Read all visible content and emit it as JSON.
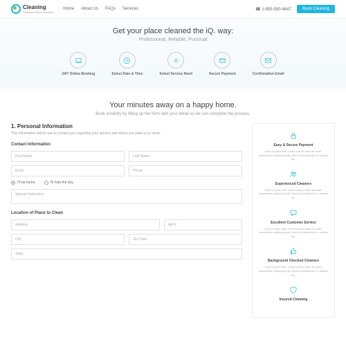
{
  "brand": {
    "name": "Cleaning",
    "tagline": "Premium Home Services"
  },
  "nav": {
    "links": [
      "Home",
      "About Us",
      "FAQs",
      "Services"
    ],
    "phone": "☎ 1-855-550-4647",
    "cta": "Book Cleaning"
  },
  "hero": {
    "title": "Get your place cleaned the iQ. way:",
    "subtitle": "Professional, Reliable, Punctual"
  },
  "steps": [
    {
      "label": "24/7 Online Booking"
    },
    {
      "label": "Select Date & Time"
    },
    {
      "label": "Select Service Need"
    },
    {
      "label": "Secure Payment"
    },
    {
      "label": "Confirmation Email"
    }
  ],
  "mid": {
    "title": "Your minutes away on a happy home.",
    "subtitle": "Book instantly by filling up the form with your detail so we can complete the process."
  },
  "form": {
    "section_title": "1. Personal Information",
    "section_desc": "This information will be use to contact you regarding your service and where you want us to clean.",
    "contact_title": "Contact Information",
    "fields": {
      "first": "First Name",
      "last": "Last Name",
      "email": "Email",
      "phone": "Phone",
      "instruction": "Special Instruction"
    },
    "radio1": "I'll be home.",
    "radio2": "I'll hide the key.",
    "location_title": "Location of Place to Clean",
    "loc": {
      "address": "Address",
      "apt": "Apt #",
      "city": "City",
      "zip": "Zip Code",
      "state": "State"
    }
  },
  "features": [
    {
      "title": "Easy & Secure Payment",
      "desc": "Duis eu justo erat. Lorem ipsum dolor sit amet, consectetur adipiscing elit. Morbi a blandit nisl, in ultrices leo."
    },
    {
      "title": "Experienced Cleaners",
      "desc": "Duis eu justo erat. Lorem ipsum dolor sit amet, consectetur adipiscing elit. Morbi a blandit nisl, in ultrices leo."
    },
    {
      "title": "Excellent Customer Service",
      "desc": "Duis eu justo erat. Lorem ipsum dolor sit amet, consectetur adipiscing elit. Morbi a blandit nisl, in ultrices leo."
    },
    {
      "title": "Background Checked Cleaners",
      "desc": "Duis eu justo erat. Lorem ipsum dolor sit amet, consectetur adipiscing elit. Morbi a blandit nisl, in ultrices leo."
    },
    {
      "title": "Insured Cleaning",
      "desc": ""
    }
  ]
}
